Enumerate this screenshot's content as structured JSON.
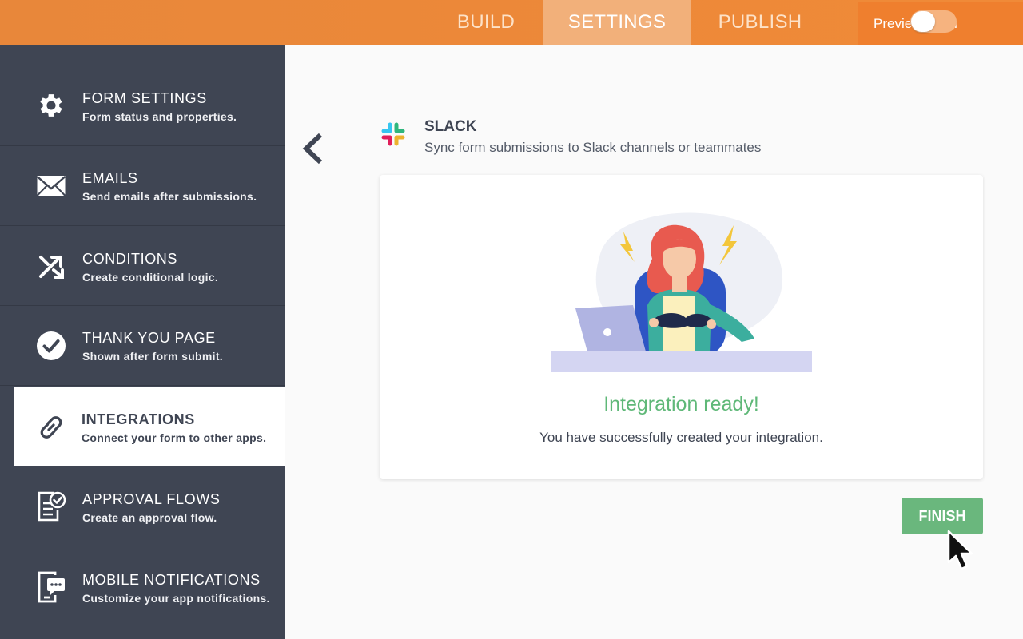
{
  "tabs": [
    {
      "label": "BUILD"
    },
    {
      "label": "SETTINGS",
      "active": true
    },
    {
      "label": "PUBLISH"
    }
  ],
  "preview": {
    "label": "Preview Form",
    "enabled": false
  },
  "sidebar": {
    "items": [
      {
        "title": "FORM SETTINGS",
        "subtitle": "Form status and properties.",
        "icon": "gear-icon"
      },
      {
        "title": "EMAILS",
        "subtitle": "Send emails after submissions.",
        "icon": "envelope-icon"
      },
      {
        "title": "CONDITIONS",
        "subtitle": "Create conditional logic.",
        "icon": "conditions-icon"
      },
      {
        "title": "THANK YOU PAGE",
        "subtitle": "Shown after form submit.",
        "icon": "check-circle-icon"
      },
      {
        "title": "INTEGRATIONS",
        "subtitle": "Connect your form to other apps.",
        "icon": "link-icon",
        "active": true
      },
      {
        "title": "APPROVAL FLOWS",
        "subtitle": "Create an approval flow.",
        "icon": "approval-icon"
      },
      {
        "title": "MOBILE NOTIFICATIONS",
        "subtitle": "Customize your app notifications.",
        "icon": "mobile-notification-icon"
      }
    ]
  },
  "integration": {
    "name": "SLACK",
    "description": "Sync form submissions to Slack channels or teammates"
  },
  "card": {
    "heading": "Integration ready!",
    "message": "You have successfully created your integration."
  },
  "finish_label": "FINISH",
  "colors": {
    "accent": "#f08a38",
    "sidebar": "#3f4553",
    "success": "#5fb878",
    "button": "#6ab77d"
  }
}
